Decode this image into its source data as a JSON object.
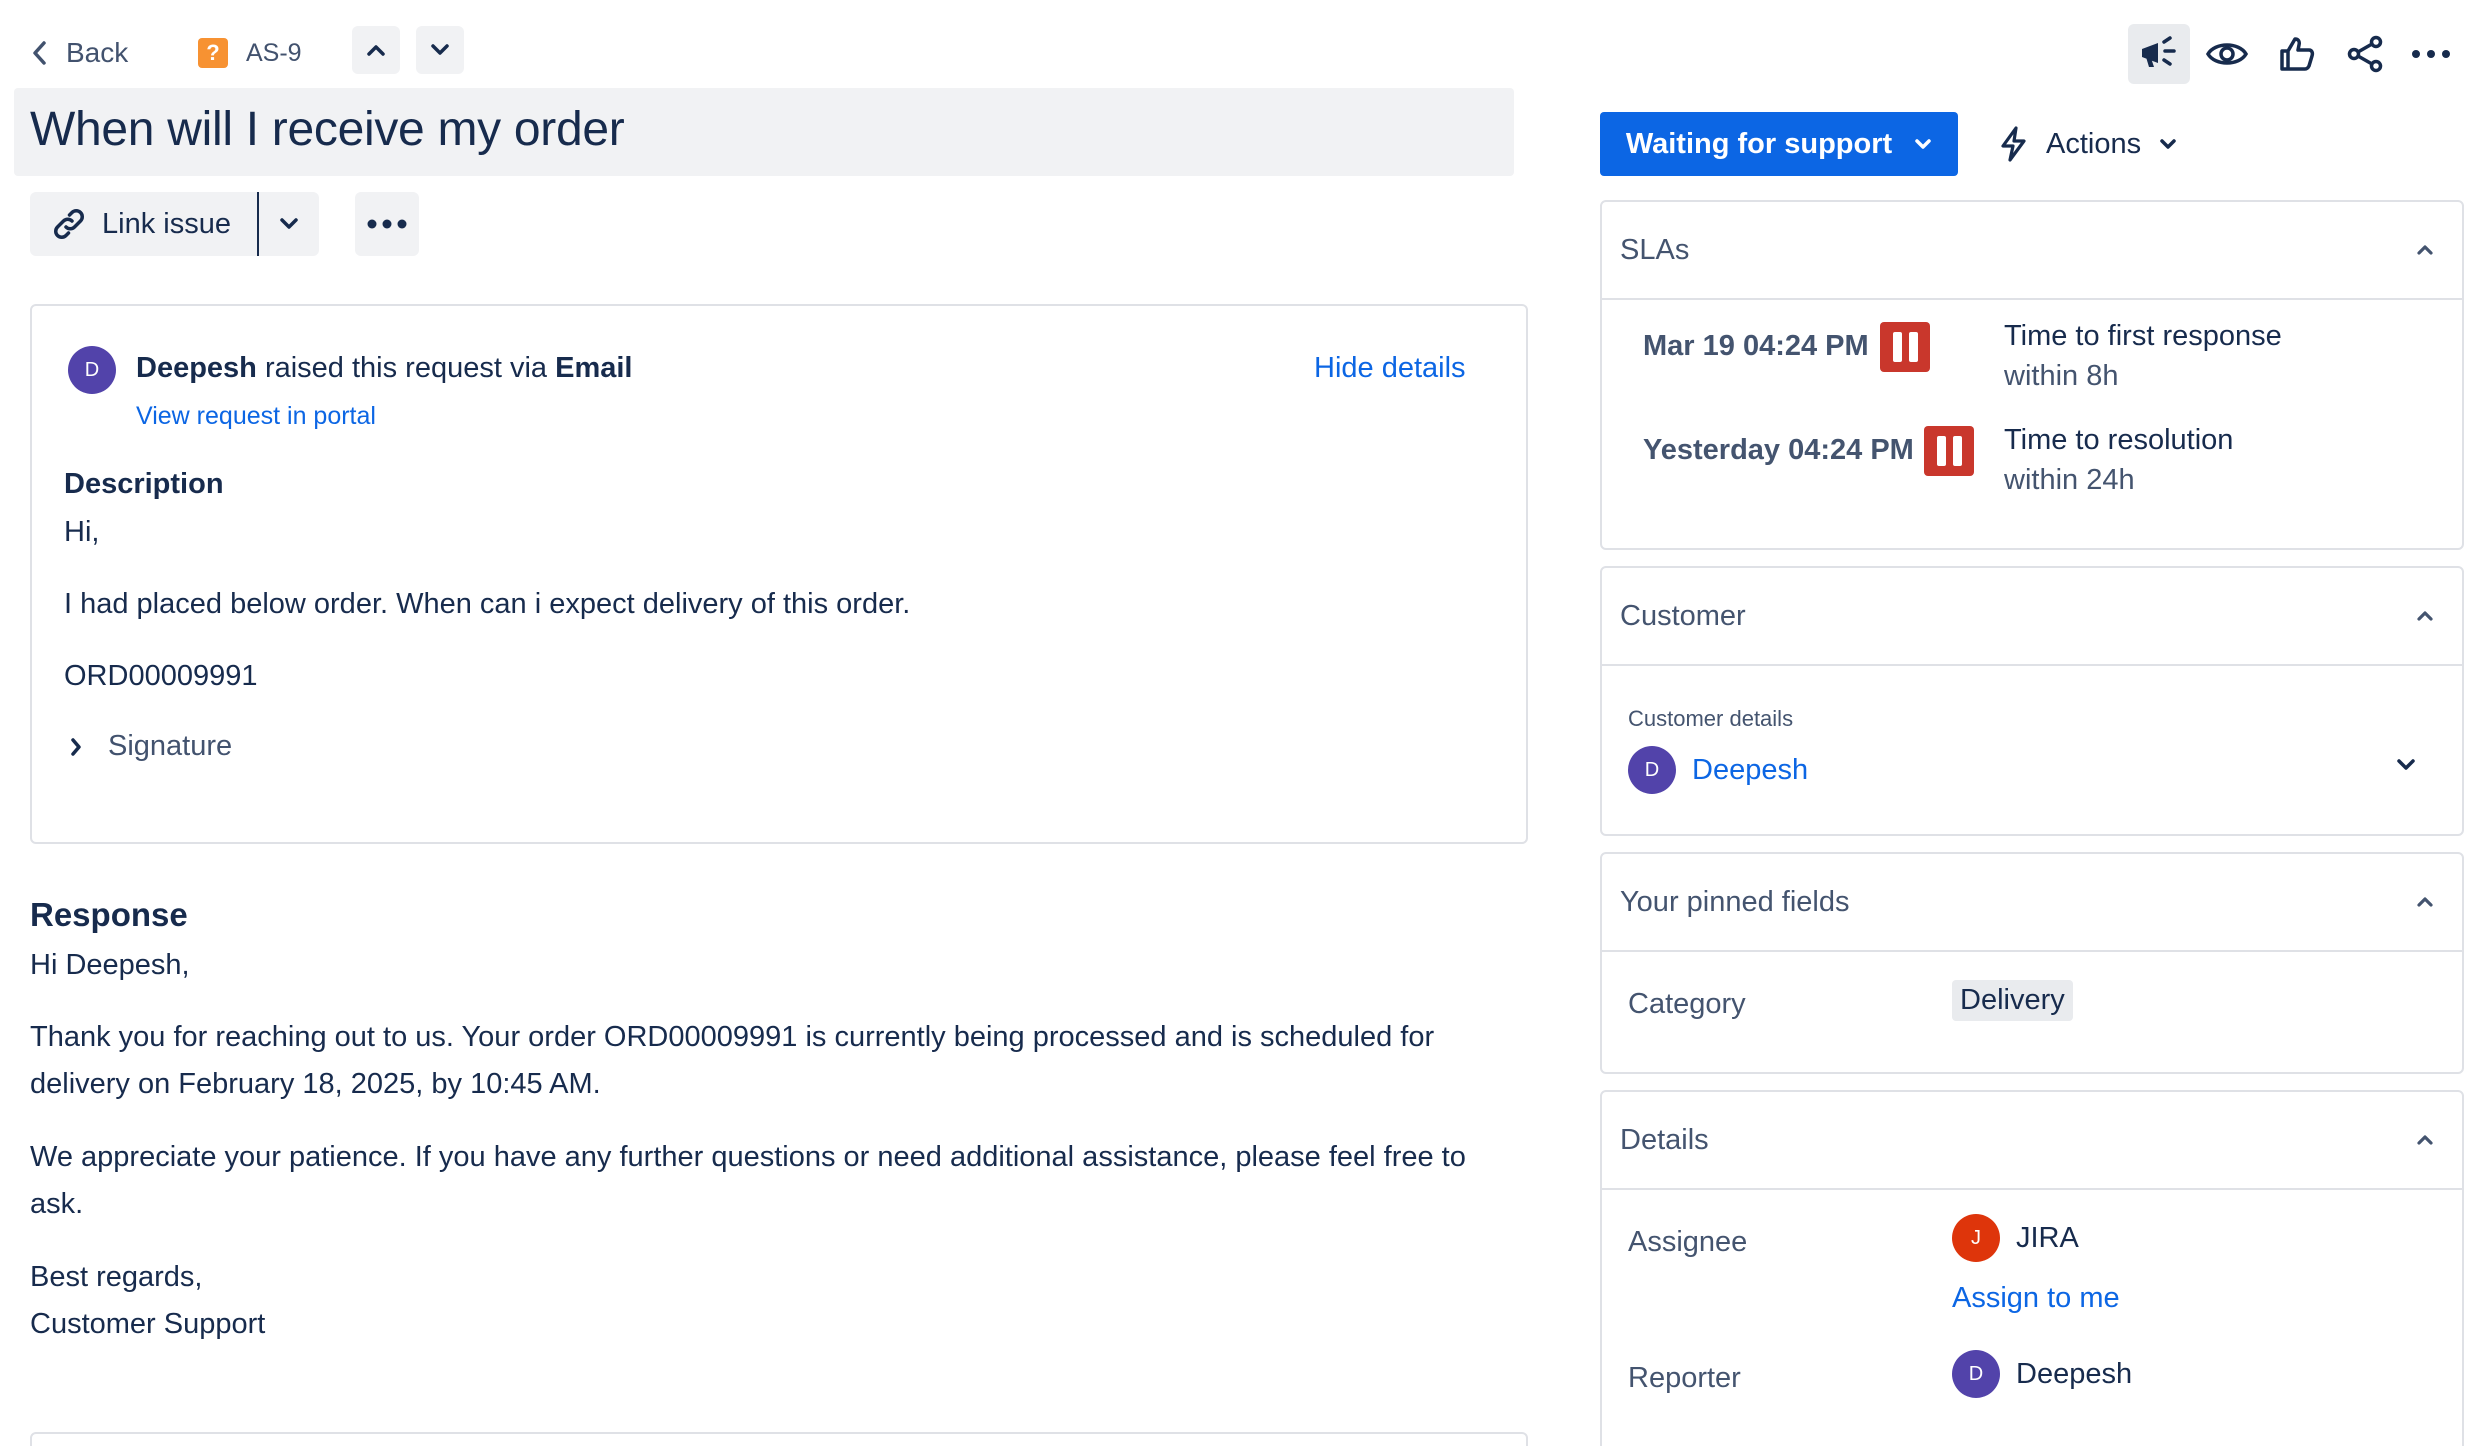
{
  "header": {
    "back_label": "Back",
    "issue_key": "AS-9",
    "issue_type_glyph": "?",
    "title": "When will I receive my order"
  },
  "toolbar": {
    "link_issue_label": "Link issue"
  },
  "request": {
    "reporter": "Deepesh",
    "reporter_initial": "D",
    "raised_text": "raised this request via",
    "channel": "Email",
    "portal_link": "View request in portal",
    "hide_details": "Hide details",
    "description_heading": "Description",
    "description_lines": [
      "Hi,",
      "I had placed below order. When can i expect delivery of this order.",
      "ORD00009991"
    ],
    "signature_label": "Signature"
  },
  "response": {
    "heading": "Response",
    "paragraphs": [
      "Hi Deepesh,",
      "Thank you for reaching out to us. Your order ORD00009991 is currently being processed and is scheduled for delivery on February 18, 2025, by 10:45 AM.",
      "We appreciate your patience. If you have any further questions or need additional assistance, please feel free to ask.",
      "Best regards,",
      "Customer Support"
    ]
  },
  "sidebar": {
    "status_label": "Waiting for support",
    "actions_label": "Actions",
    "slas": {
      "heading": "SLAs",
      "items": [
        {
          "date": "Mar 19 04:24 PM",
          "name": "Time to first response",
          "goal": "within 8h"
        },
        {
          "date": "Yesterday 04:24 PM",
          "name": "Time to resolution",
          "goal": "within 24h"
        }
      ]
    },
    "customer": {
      "heading": "Customer",
      "details_label": "Customer details",
      "name": "Deepesh",
      "initial": "D"
    },
    "pinned": {
      "heading": "Your pinned fields",
      "category_label": "Category",
      "category_value": "Delivery"
    },
    "details": {
      "heading": "Details",
      "assignee_label": "Assignee",
      "assignee_name": "JIRA",
      "assignee_initial": "J",
      "assign_to_me": "Assign to me",
      "reporter_label": "Reporter",
      "reporter_name": "Deepesh",
      "reporter_initial": "D"
    }
  },
  "colors": {
    "primary": "#0c66e4",
    "sla_paused": "#c9372c",
    "avatar_purple": "#5243aa",
    "avatar_orange": "#de350b",
    "issue_type": "#f79232"
  },
  "icons": [
    "chevron-left-icon",
    "question-issue-icon",
    "chevron-up-icon",
    "chevron-down-icon",
    "link-icon",
    "more-icon",
    "megaphone-icon",
    "eye-icon",
    "thumbs-up-icon",
    "share-icon",
    "lightning-icon",
    "pause-icon"
  ]
}
